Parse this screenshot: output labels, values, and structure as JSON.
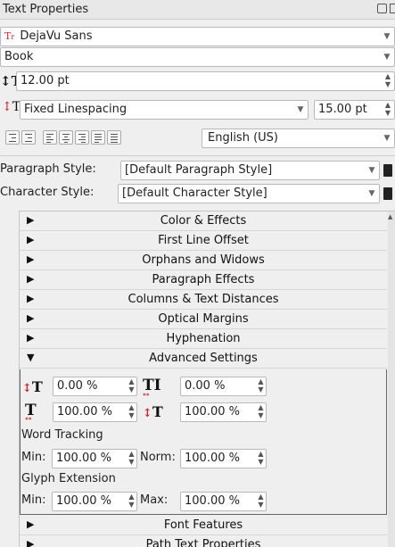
{
  "panel": {
    "title": "Text Properties",
    "icons": {
      "float": "float-icon",
      "close": "close-icon"
    }
  },
  "font": {
    "family": "DejaVu Sans",
    "family_icon": "font-type-icon",
    "style": "Book",
    "size": "12.00 pt",
    "size_icon": "font-size-icon"
  },
  "spacing": {
    "mode": "Fixed Linespacing",
    "value": "15.00 pt",
    "icon": "linespacing-icon"
  },
  "alignment": {
    "buttons": [
      "indent-increase-icon",
      "indent-decrease-icon",
      "align-left-icon",
      "align-center-icon",
      "align-right-icon",
      "align-justify-icon",
      "align-force-justify-icon"
    ],
    "language": "English (US)"
  },
  "styles": {
    "paragraph_label": "Paragraph Style:",
    "paragraph_value": "[Default Paragraph Style]",
    "character_label": "Character Style:",
    "character_value": "[Default Character Style]",
    "edit_icon": "edit-style-icon"
  },
  "sections": [
    {
      "label": "Color & Effects",
      "expanded": false
    },
    {
      "label": "First Line Offset",
      "expanded": false
    },
    {
      "label": "Orphans and Widows",
      "expanded": false
    },
    {
      "label": "Paragraph Effects",
      "expanded": false
    },
    {
      "label": "Columns & Text Distances",
      "expanded": false
    },
    {
      "label": "Optical Margins",
      "expanded": false
    },
    {
      "label": "Hyphenation",
      "expanded": false
    },
    {
      "label": "Advanced Settings",
      "expanded": true
    }
  ],
  "advanced": {
    "baseline_offset": "0.00 %",
    "tracking": "0.00 %",
    "scale_width": "100.00 %",
    "scale_height": "100.00 %",
    "word_tracking_label": "Word Tracking",
    "min_label": "Min:",
    "word_min": "100.00 %",
    "norm_label": "Norm:",
    "word_norm": "100.00 %",
    "glyph_extension_label": "Glyph Extension",
    "glyph_min": "100.00 %",
    "max_label": "Max:",
    "glyph_max": "100.00 %"
  },
  "sections_after": [
    {
      "label": "Font Features",
      "expanded": false
    },
    {
      "label": "Path Text Properties",
      "expanded": false
    }
  ],
  "colors": {
    "accent_red": "#d2232a",
    "panel_bg": "#efefef"
  }
}
